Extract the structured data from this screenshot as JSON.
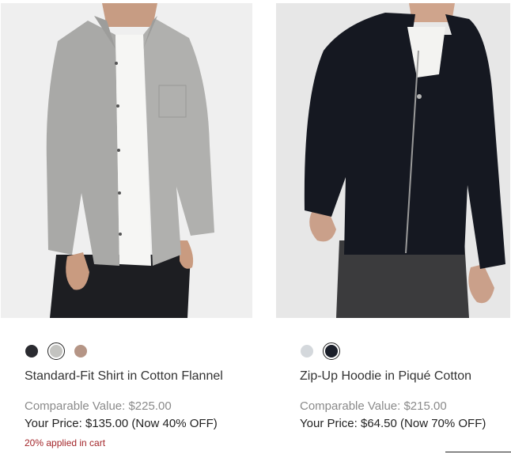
{
  "products": [
    {
      "name": "Standard-Fit Shirt in Cotton Flannel",
      "comparable_value": "Comparable Value: $225.00",
      "your_price": "Your Price: $135.00 (Now 40% OFF)",
      "promo": "20% applied in cart",
      "swatches": [
        {
          "color": "#2a2b30",
          "selected": false
        },
        {
          "color": "#c3c3c0",
          "selected": true
        },
        {
          "color": "#b59586",
          "selected": false
        }
      ]
    },
    {
      "name": "Zip-Up Hoodie in Piqué Cotton",
      "comparable_value": "Comparable Value: $215.00",
      "your_price": "Your Price: $64.50 (Now 70% OFF)",
      "swatches": [
        {
          "color": "#d4d8dc",
          "selected": false
        },
        {
          "color": "#1b1f2a",
          "selected": true
        }
      ]
    }
  ]
}
